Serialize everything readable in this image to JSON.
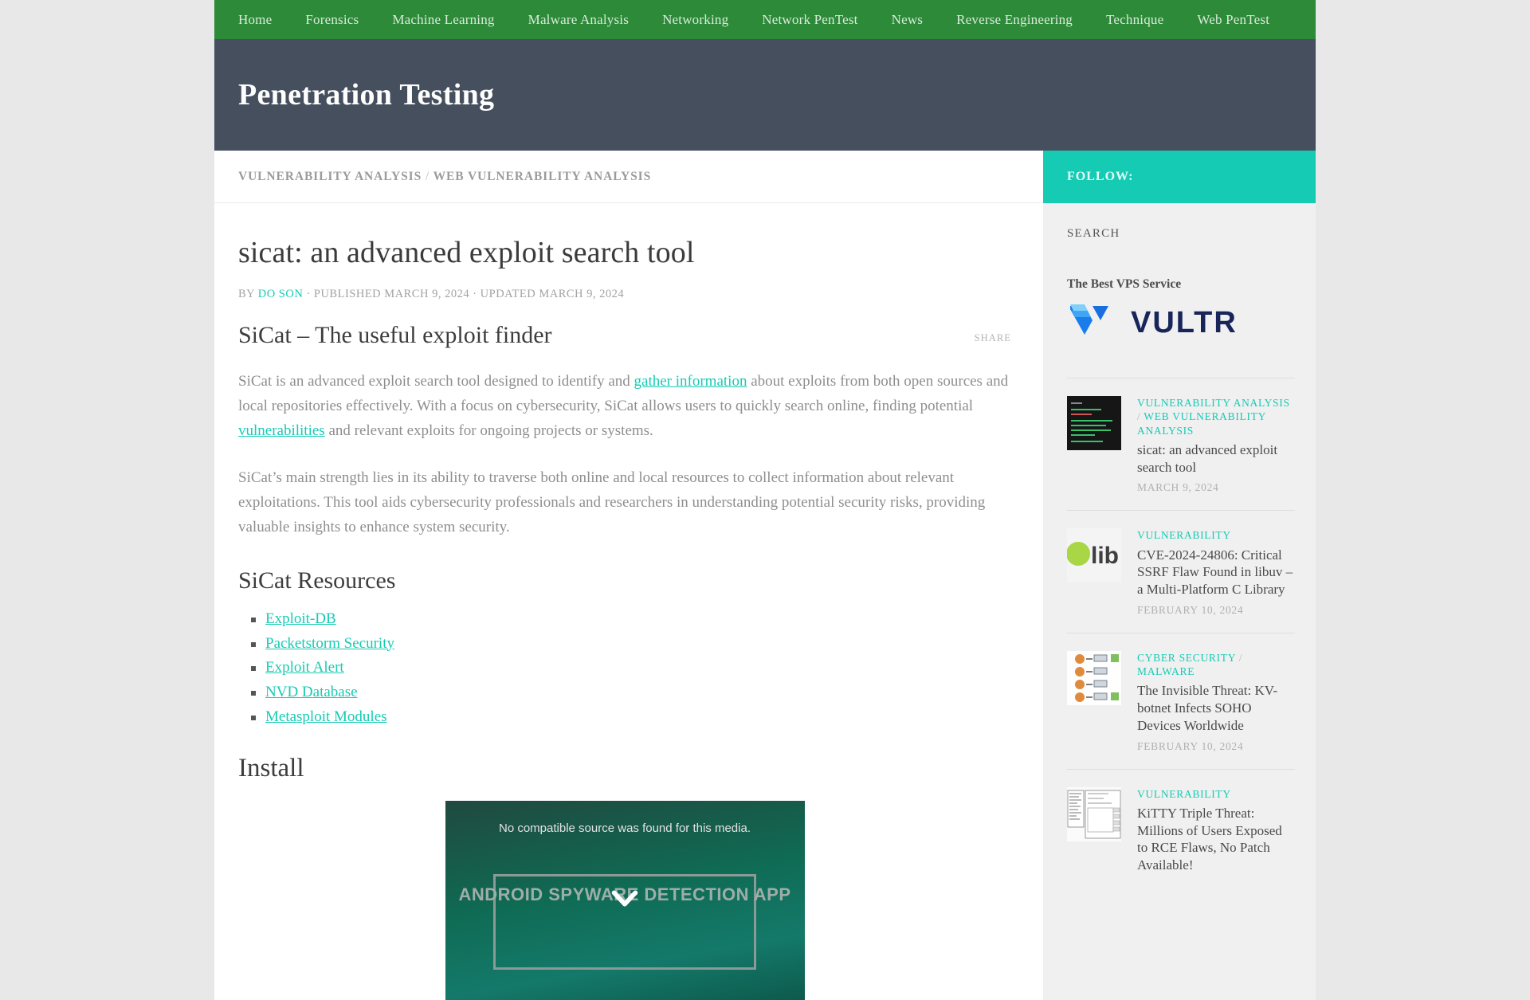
{
  "nav": {
    "items": [
      {
        "label": "Home"
      },
      {
        "label": "Forensics"
      },
      {
        "label": "Machine Learning"
      },
      {
        "label": "Malware Analysis"
      },
      {
        "label": "Networking"
      },
      {
        "label": "Network PenTest"
      },
      {
        "label": "News"
      },
      {
        "label": "Reverse Engineering"
      },
      {
        "label": "Technique"
      },
      {
        "label": "Web PenTest"
      }
    ]
  },
  "hero": {
    "title": "Penetration Testing"
  },
  "breadcrumb": {
    "first": "VULNERABILITY ANALYSIS",
    "separator": "/",
    "second": "WEB VULNERABILITY ANALYSIS"
  },
  "sidebar": {
    "follow_title": "FOLLOW:",
    "search_label": "SEARCH",
    "ad": {
      "title": "The Best VPS Service",
      "logo_text": "VULTR"
    },
    "posts": [
      {
        "categories": [
          "VULNERABILITY ANALYSIS",
          "WEB VULNERABILITY ANALYSIS"
        ],
        "title": "sicat: an advanced exploit search tool",
        "date": "MARCH 9, 2024",
        "thumb": "terminal-thumbnail"
      },
      {
        "categories": [
          "VULNERABILITY"
        ],
        "title": "CVE-2024-24806: Critical SSRF Flaw Found in libuv – a Multi-Platform C Library",
        "date": "FEBRUARY 10, 2024",
        "thumb": "libuv-logo-thumbnail"
      },
      {
        "categories": [
          "CYBER SECURITY",
          "MALWARE"
        ],
        "title": "The Invisible Threat: KV-botnet Infects SOHO Devices Worldwide",
        "date": "FEBRUARY 10, 2024",
        "thumb": "network-diagram-thumbnail"
      },
      {
        "categories": [
          "VULNERABILITY"
        ],
        "title": "KiTTY Triple Threat: Millions of Users Exposed to RCE Flaws, No Patch Available!",
        "date": "",
        "thumb": "kitty-dialog-thumbnail"
      }
    ]
  },
  "article": {
    "title": "sicat: an advanced exploit search tool",
    "meta": {
      "by": "BY",
      "author": "DO SON",
      "published": "· PUBLISHED MARCH 9, 2024 · UPDATED MARCH 9, 2024"
    },
    "share_label": "SHARE",
    "heading_1": "SiCat – The useful exploit finder",
    "para_1_a": "SiCat is an advanced exploit search tool designed to identify and ",
    "para_1_link": "gather information",
    "para_1_b": " about exploits from both open sources and local repositories effectively. With a focus on cybersecurity, SiCat allows users to quickly search online, finding potential ",
    "para_1_link2": "vulnerabilities",
    "para_1_c": " and relevant exploits for ongoing projects or systems.",
    "para_2": "SiCat’s main strength lies in its ability to traverse both online and local resources to collect information about relevant exploitations. This tool aids cybersecurity professionals and researchers in understanding potential security risks, providing valuable insights to enhance system security.",
    "heading_2": "SiCat Resources",
    "resources": [
      {
        "label": "Exploit-DB"
      },
      {
        "label": "Packetstorm Security"
      },
      {
        "label": "Exploit Alert"
      },
      {
        "label": "NVD Database"
      },
      {
        "label": "Metasploit Modules"
      }
    ],
    "heading_3": "Install",
    "video": {
      "message": "No compatible source was found for this media.",
      "banner_text": "ANDROID SPYWARE DETECTION APP"
    }
  },
  "colors": {
    "nav_green": "#2d8a39",
    "hero_slate": "#454f5e",
    "accent_teal": "#16cbb4",
    "sidebar_bg": "#f0f0f0"
  }
}
